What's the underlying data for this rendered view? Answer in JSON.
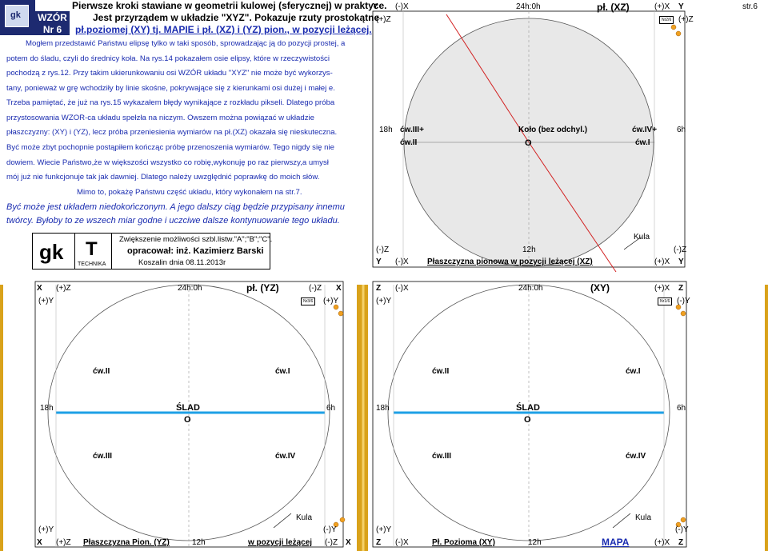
{
  "header": {
    "logo_text": "gk",
    "lines": [
      "Pierwsze kroki stawiane w geometrii kulowej (sferycznej) w praktyce.",
      "Jest przyrządem w układzie \"XYZ\". Pokazuje rzuty prostokątne",
      "pł.poziomej (XY) tj. MAPIE i pł. (XZ) i (YZ) pion., w pozycji leżącej."
    ],
    "left_tags": [
      "WZÓR",
      "Nr 6"
    ]
  },
  "body_text": [
    "Mogłem przedstawić Państwu elipsę tylko w taki sposób, sprowadzając ją do pozycji prostej, a",
    "potem do śladu, czyli do średnicy koła. Na rys.14 pokazałem osie elipsy, które w rzeczywistości",
    "pochodzą z rys.12. Przy takim ukierunkowaniu osi WZÓR układu \"XYZ\" nie może być wykorzys-",
    "tany, ponieważ w grę wchodziły by linie skośne, pokrywające się z kierunkami osi dużej i małej e.",
    "Trzeba pamiętać, że już na rys.15 wykazałem błędy wynikające z rozkładu pikseli. Dlatego próba",
    "przystosowania WZOR-ca układu spełzła na niczym. Owszem można powiązać w układzie",
    "płaszczyzny: (XY) i (YZ), lecz próba przeniesienia wymiarów na pł.(XZ) okazała się nieskuteczna.",
    "Być może zbyt pochopnie postąpiłem kończąc próbę przenoszenia wymiarów. Tego nigdy się nie",
    "dowiem. Wiecie Państwo,że w większości wszystko co robię,wykonuję po raz pierwszy,a umysł",
    "mój już nie funkcjonuje tak jak dawniej. Dlatego należy uwzględnić poprawkę do moich słów.",
    "Mimo to, pokażę Państwu część układu, który wykonałem na str.7."
  ],
  "italic_text": [
    "Być może jest układem niedokończonym. A jego dalszy ciąg będzie przypisany innemu",
    "twórcy. Byłoby to ze wszech miar godne i uczciwe dalsze kontynuowanie tego układu."
  ],
  "footer_box": {
    "gk": "gk",
    "t": "T",
    "technika": "TECHNIKA",
    "line1": "Zwiększenie możliwości szbl.listw.\"A\";\"B\";\"C\".",
    "line2": "opracował:  inż. Kazimierz Barski",
    "line3": "Koszalin dnia 08.11.2013r"
  },
  "page_label": "str.6",
  "panels": {
    "xz": {
      "title": "pł. (XZ)",
      "nr": "Nr2/6",
      "top_labels": [
        "Y",
        "(-)X",
        "24h:0h",
        "(+)X",
        "Y"
      ],
      "left_top": "(+)Z",
      "right_top": "(+)Z",
      "mid_left": "18h",
      "mid_right": "6h",
      "cw_iii": "ćw.III+",
      "cw_iv": "ćw.IV+",
      "cw_ii": "ćw.II",
      "cw_i": "ćw.I",
      "center_title": "Koło (bez odchyl.)",
      "center_o": "O",
      "kula": "Kula",
      "bottom_left_z": "(-)Z",
      "bottom_right_z": "(-)Z",
      "bottom_12h": "12h",
      "bottom_row": [
        "Y",
        "(-)X",
        "Płaszczyzna pionowa w pozycji leżącej (XZ)",
        "(+)X",
        "Y"
      ]
    },
    "yz": {
      "title": "pł. (YZ)",
      "nr": "Nr3/6",
      "top_labels": [
        "X",
        "(+)Z",
        "24h:0h",
        "(-)Z",
        "X"
      ],
      "left_top": "(+)Y",
      "right_top": "(+)Y",
      "cw_ii": "ćw.II",
      "cw_i": "ćw.I",
      "cw_iii": "ćw.III",
      "cw_iv": "ćw.IV",
      "mid_left": "18h",
      "mid_right": "6h",
      "slad": "ŚLAD",
      "center_o": "O",
      "kula": "Kula",
      "bottom_left_y": "(+)Y",
      "bottom_right_y": "(-)Y",
      "bottom_row": [
        "X",
        "(+)Z",
        "Płaszczyzna Pion. (YZ)",
        "12h",
        "w pozycji leżącej",
        "(-)Z",
        "X"
      ]
    },
    "xy": {
      "title": "(XY)",
      "nr": "Nr1/6",
      "top_labels": [
        "Z",
        "(-)X",
        "24h:0h",
        "(+)X",
        "Z"
      ],
      "left_top": "(+)Y",
      "right_top": "(-)Y",
      "cw_ii": "ćw.II",
      "cw_i": "ćw.I",
      "cw_iii": "ćw.III",
      "cw_iv": "ćw.IV",
      "mid_left": "18h",
      "mid_right": "6h",
      "slad": "ŚLAD",
      "center_o": "O",
      "kula": "Kula",
      "bottom_left_y": "(+)Y",
      "bottom_right_y": "(-)Y",
      "bottom_row": [
        "Z",
        "(-)X",
        "Pł. Pozioma (XY)",
        "12h",
        "MAPA",
        "(+)X",
        "Z"
      ]
    }
  },
  "colors": {
    "blue_text": "#1a2cb0",
    "navy": "#1d2a70",
    "gold": "#d9a21b",
    "axis_blue": "#1ea0e6",
    "red_line": "#d22020",
    "circle_fill": "#e8e8e8"
  }
}
